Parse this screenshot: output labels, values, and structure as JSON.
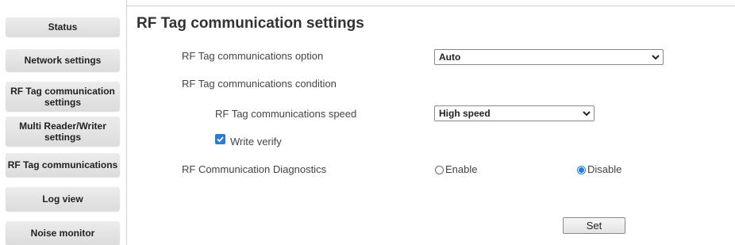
{
  "sidebar": {
    "items": [
      {
        "label": "Status"
      },
      {
        "label": "Network settings"
      },
      {
        "label": "RF Tag communication settings"
      },
      {
        "label": "Multi Reader/Writer settings"
      },
      {
        "label": "RF Tag communications"
      },
      {
        "label": "Log view"
      },
      {
        "label": "Noise monitor"
      }
    ]
  },
  "main": {
    "title": "RF Tag communication settings",
    "comm_option": {
      "label": "RF Tag communications option",
      "value": "Auto"
    },
    "comm_condition": {
      "label": "RF Tag communications condition"
    },
    "comm_speed": {
      "label": "RF Tag communications speed",
      "value": "High speed"
    },
    "write_verify": {
      "label": "Write verify",
      "checked": true
    },
    "diagnostics": {
      "label": "RF Communication Diagnostics",
      "enable_label": "Enable",
      "disable_label": "Disable",
      "selected": "Disable"
    },
    "set_label": "Set"
  },
  "colors": {
    "accent": "#2b7bd6",
    "nav_bg": "#e4e4e4"
  },
  "icons": {
    "select_arrow": "chevron-down-icon",
    "check": "check-icon"
  }
}
